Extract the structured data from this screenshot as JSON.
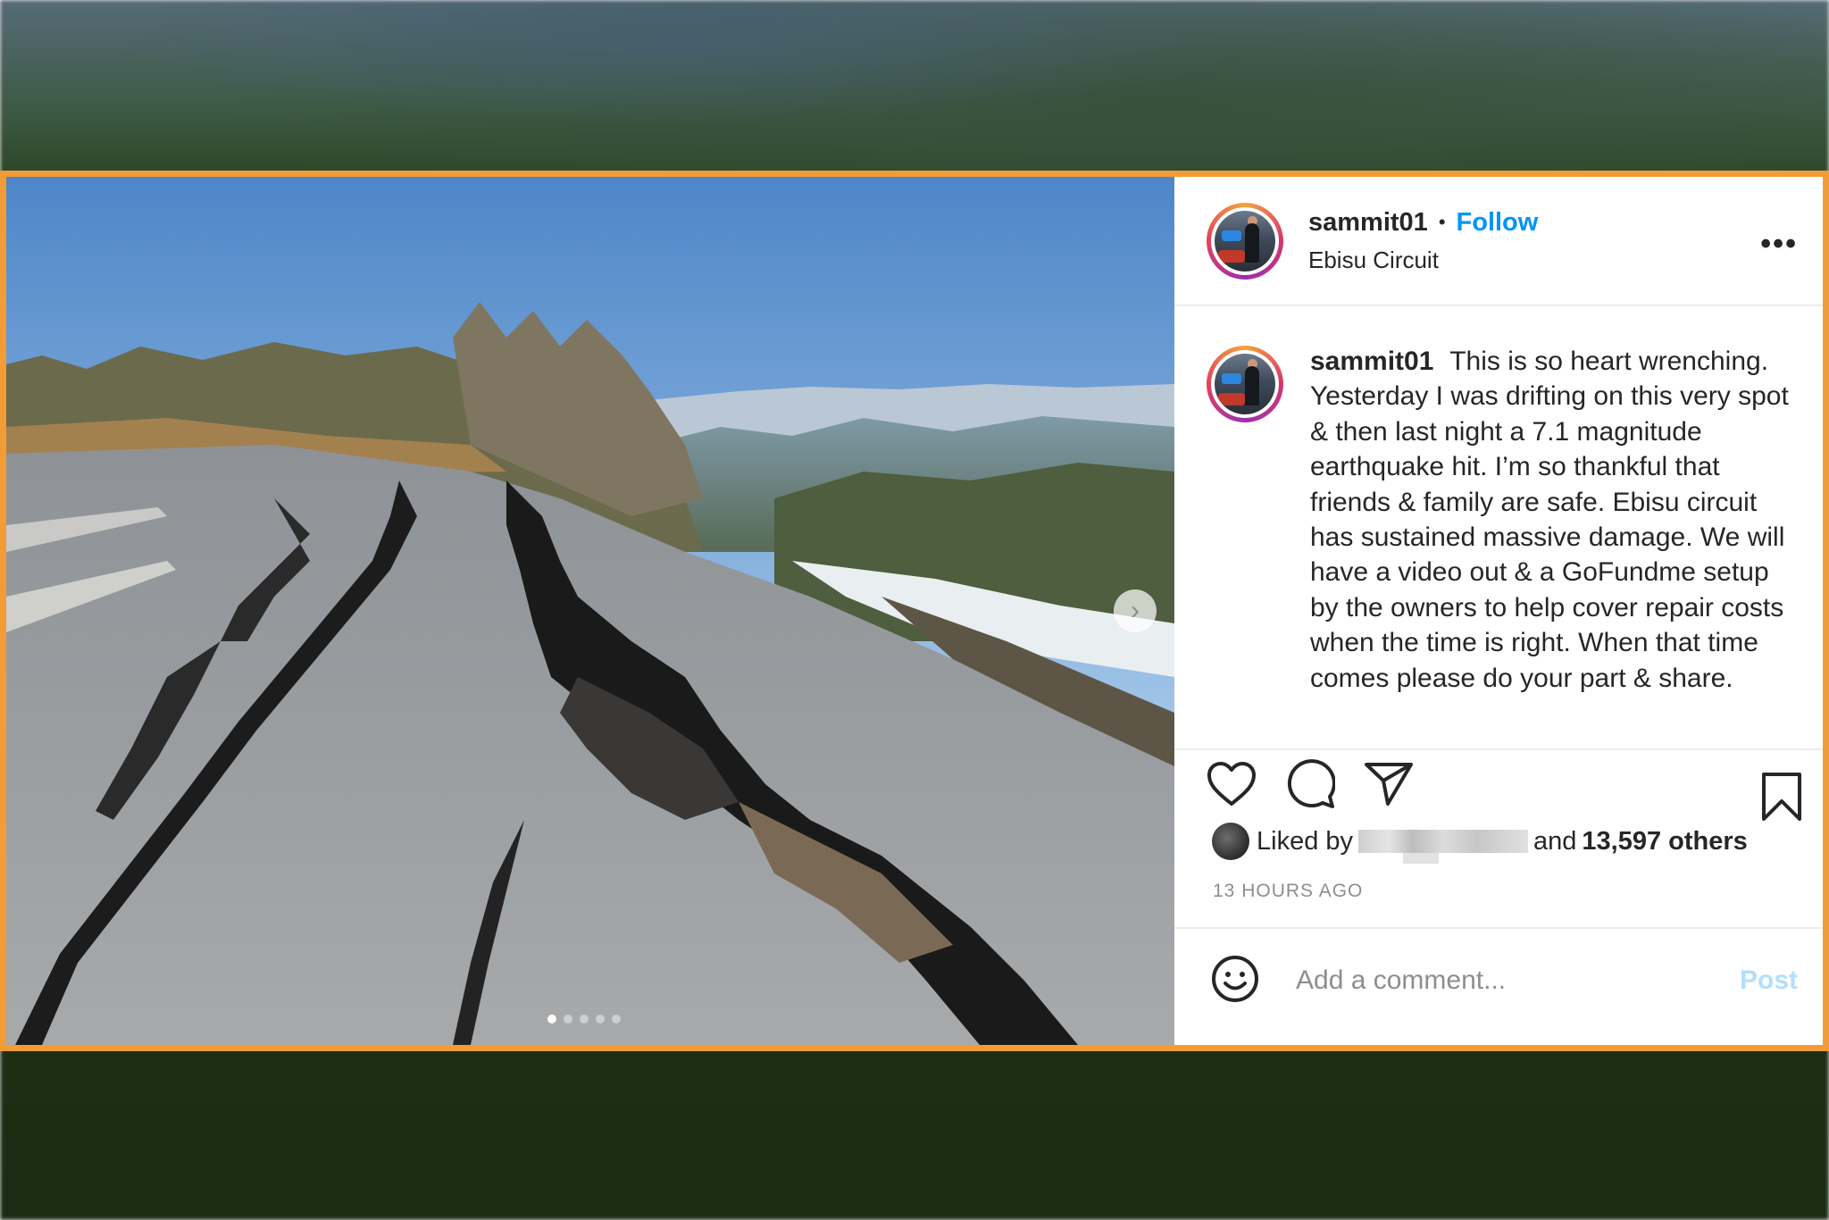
{
  "post": {
    "username": "sammit01",
    "separator": "•",
    "follow_label": "Follow",
    "location": "Ebisu Circuit",
    "more_label": "•••",
    "caption_text": "This is so heart wrenching. Yesterday I was drifting on this very spot & then last night a 7.1 magnitude earthquake hit. I’m so thankful that friends & family are safe. Ebisu circuit has sustained massive damage. We will have a video out & a GoFundme setup by the owners to help cover repair costs when the time is right. When that time comes please do your part & share.",
    "liked_by_prefix": "Liked by",
    "liked_by_suffix": "and",
    "likes_count": "13,597 others",
    "timestamp": "13 HOURS AGO",
    "comment_placeholder": "Add a comment...",
    "post_label": "Post",
    "next_arrow": "›",
    "carousel": {
      "count": 5,
      "active_index": 0
    }
  },
  "icons": {
    "like": "heart-icon",
    "comment": "comment-bubble-icon",
    "share": "paper-plane-icon",
    "save": "bookmark-icon",
    "emoji": "smiley-icon",
    "more": "more-options-icon"
  },
  "colors": {
    "frame_border": "#f29c38",
    "follow": "#0095f6",
    "post_disabled": "#b2dffc",
    "text": "#262626",
    "muted": "#8e8e8e"
  }
}
